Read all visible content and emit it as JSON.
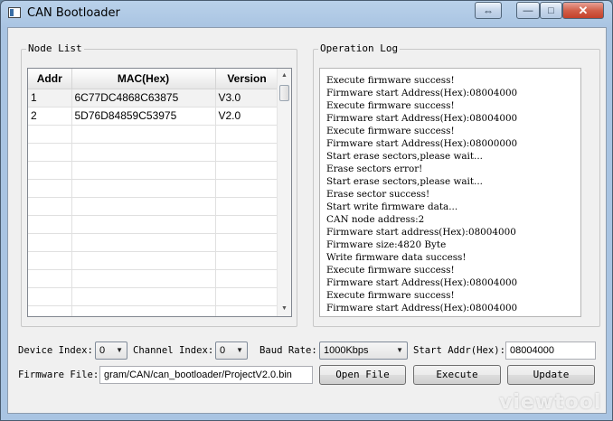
{
  "window": {
    "title": "CAN Bootloader",
    "controls": {
      "nav_glyph": "⇔",
      "minimize_glyph": "—",
      "maximize_glyph": "□",
      "close_glyph": "✕"
    }
  },
  "node_list": {
    "label": "Node List",
    "columns": [
      "Addr",
      "MAC(Hex)",
      "Version"
    ],
    "rows": [
      {
        "addr": "1",
        "mac": "6C77DC4868C63875",
        "version": "V3.0"
      },
      {
        "addr": "2",
        "mac": "5D76D84859C53975",
        "version": "V2.0"
      }
    ]
  },
  "operation_log": {
    "label": "Operation Log",
    "lines": [
      "Execute firmware success!",
      "Firmware start Address(Hex):08004000",
      "Execute firmware success!",
      "Firmware start Address(Hex):08004000",
      "Execute firmware success!",
      "Firmware start Address(Hex):08000000",
      "Start erase sectors,please wait...",
      "Erase sectors error!",
      "Start erase sectors,please wait...",
      "Erase sector success!",
      "Start write firmware data...",
      "CAN node address:2",
      "Firmware start address(Hex):08004000",
      "Firmware size:4820 Byte",
      "Write firmware data success!",
      "Execute firmware success!",
      "Firmware start Address(Hex):08004000",
      "Execute firmware success!",
      "Firmware start Address(Hex):08004000"
    ]
  },
  "settings": {
    "device_index_label": "Device Index:",
    "device_index_value": "0",
    "channel_index_label": "Channel Index:",
    "channel_index_value": "0",
    "baud_rate_label": "Baud Rate:",
    "baud_rate_value": "1000Kbps",
    "start_addr_label": "Start Addr(Hex):",
    "start_addr_value": "08004000",
    "firmware_file_label": "Firmware File:",
    "firmware_file_value": "gram/CAN/can_bootloader/ProjectV2.0.bin"
  },
  "buttons": {
    "open_file": "Open File",
    "execute": "Execute",
    "update": "Update"
  },
  "watermark": "viewtool"
}
